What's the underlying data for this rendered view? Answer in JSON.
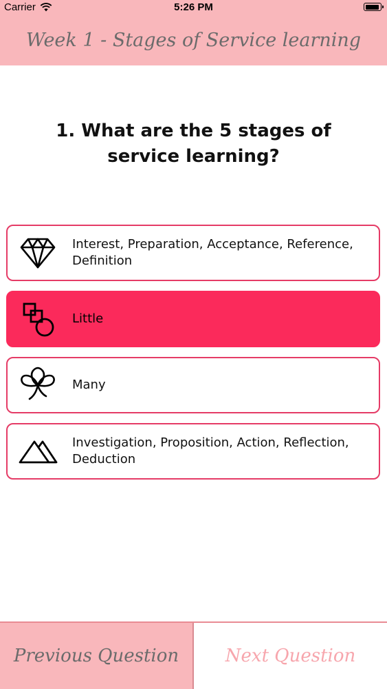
{
  "status_bar": {
    "carrier": "Carrier",
    "time": "5:26 PM"
  },
  "header": {
    "title": "Week 1 - Stages of Service learning"
  },
  "question": {
    "text": "1. What are the 5 stages of service learning?"
  },
  "options": [
    {
      "icon": "diamond-icon",
      "label": "Interest, Preparation, Acceptance, Reference, Definition",
      "selected": false
    },
    {
      "icon": "shapes-icon",
      "label": "Little",
      "selected": true
    },
    {
      "icon": "clover-icon",
      "label": "Many",
      "selected": false
    },
    {
      "icon": "mountain-icon",
      "label": "Investigation, Proposition, Action, Reflection, Deduction",
      "selected": false
    }
  ],
  "footer": {
    "prev_label": "Previous Question",
    "next_label": "Next Question"
  },
  "colors": {
    "header_bg": "#f9b7bb",
    "accent": "#fb2a5b",
    "option_border": "#e53b66",
    "next_text": "#f7a6ad"
  }
}
